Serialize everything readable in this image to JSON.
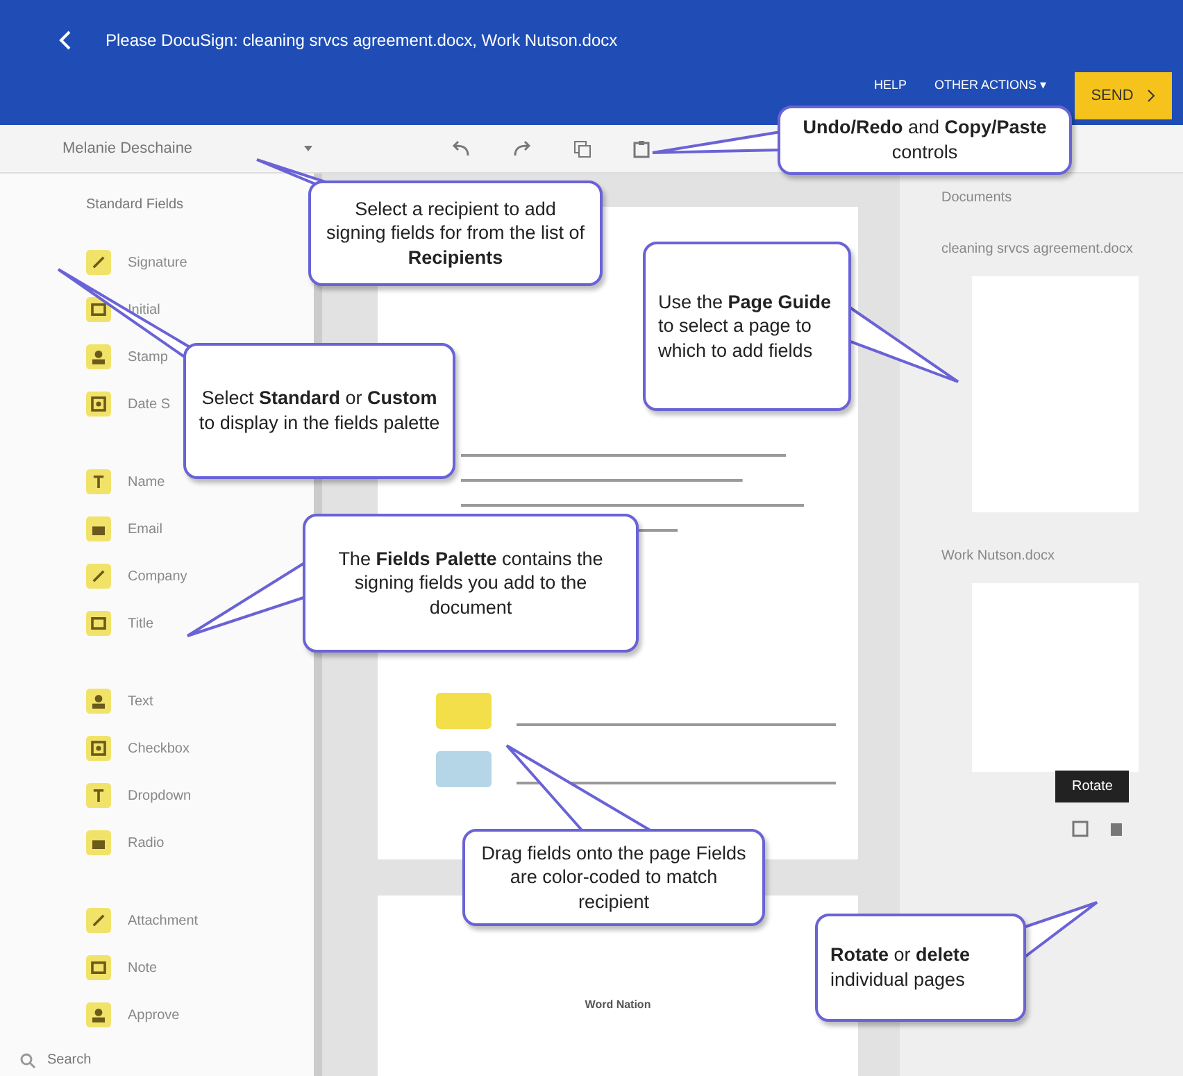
{
  "header": {
    "title": "Please DocuSign: cleaning srvcs agreement.docx, Work Nutson.docx",
    "actions": [
      "HELP",
      "OTHER ACTIONS ▾"
    ],
    "send": "SEND"
  },
  "toolbar": {
    "recipient": "Melanie Deschaine"
  },
  "palette": {
    "heading": "Standard Fields",
    "groups": [
      {
        "items": [
          "Signature",
          "Initial",
          "Stamp",
          "Date S"
        ]
      },
      {
        "items": [
          "Name",
          "Email",
          "Company",
          "Title"
        ]
      },
      {
        "items": [
          "Text",
          "Checkbox",
          "Dropdown",
          "Radio"
        ]
      },
      {
        "items": [
          "Attachment",
          "Note",
          "Approve"
        ]
      }
    ],
    "search": {
      "placeholder": "Search"
    }
  },
  "document": {
    "fields": [
      {
        "color": "#f2df4a"
      },
      {
        "color": "#b5d6e6"
      }
    ],
    "heading": "Word Nation"
  },
  "page_guide": {
    "heading": "Documents",
    "documents": [
      {
        "name": "cleaning srvcs agreement.docx"
      },
      {
        "name": "Work Nutson.docx"
      }
    ],
    "tooltip": "Rotate"
  },
  "callouts": [
    {
      "text": "**Undo/Redo** and **Copy/Paste** controls"
    },
    {
      "text": "Select a recipient to add signing fields for from the list of **Recipients**"
    },
    {
      "text": "Select **Standard** or **Custom** to display in the fields palette"
    },
    {
      "text": "Use the **Page Guide** to select a page to which to add fields"
    },
    {
      "text": "The **Fields Palette** contains the signing fields you add to the document"
    },
    {
      "text": "Drag fields onto the page Fields are color-coded to match recipient"
    },
    {
      "text": "**Rotate** or **delete** individual pages"
    }
  ]
}
